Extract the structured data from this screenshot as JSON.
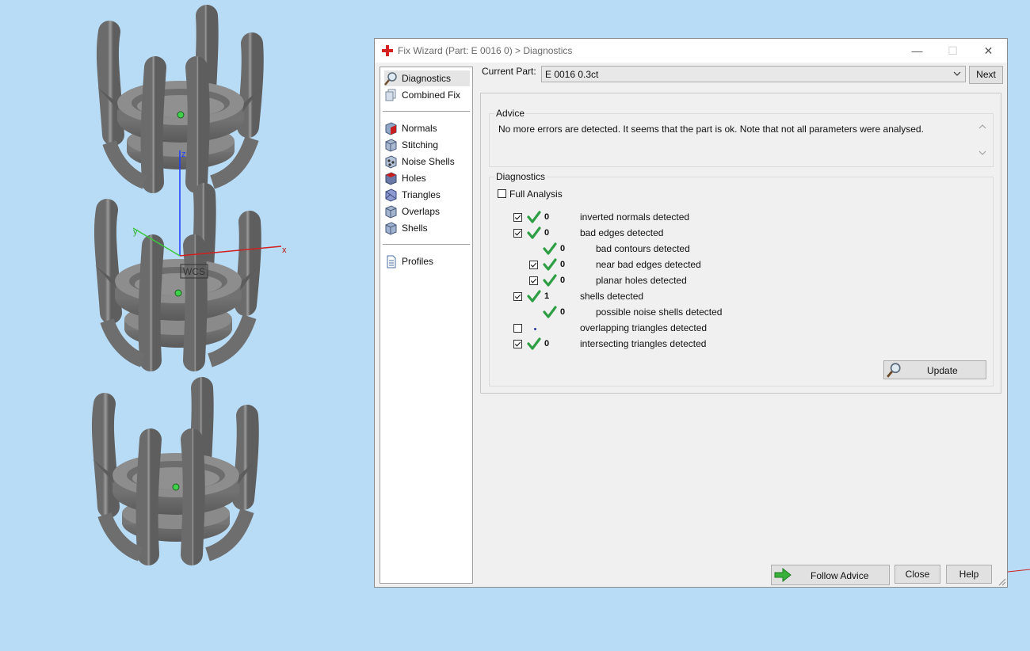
{
  "window": {
    "title": "Fix Wizard (Part: E 0016 0) > Diagnostics",
    "minimize_glyph": "—",
    "maximize_glyph": "☐",
    "close_glyph": "✕"
  },
  "nav": {
    "group1": [
      {
        "label": "Diagnostics",
        "icon": "magnifier-icon",
        "selected": true
      },
      {
        "label": "Combined Fix",
        "icon": "combined-fix-icon"
      }
    ],
    "group2": [
      {
        "label": "Normals",
        "icon": "normals-cube-icon"
      },
      {
        "label": "Stitching",
        "icon": "stitching-cube-icon"
      },
      {
        "label": "Noise Shells",
        "icon": "noise-shells-icon"
      },
      {
        "label": "Holes",
        "icon": "holes-cube-icon"
      },
      {
        "label": "Triangles",
        "icon": "triangles-cube-icon"
      },
      {
        "label": "Overlaps",
        "icon": "overlaps-cube-icon"
      },
      {
        "label": "Shells",
        "icon": "shells-cube-icon"
      }
    ],
    "group3": [
      {
        "label": "Profiles",
        "icon": "profiles-document-icon"
      }
    ]
  },
  "current_part": {
    "label": "Current Part:",
    "value": "E 0016 0.3ct",
    "next_label": "Next"
  },
  "advice": {
    "title": "Advice",
    "text": "No more errors are detected. It seems that the part is ok. Note that not all parameters were analysed."
  },
  "diagnostics": {
    "title": "Diagnostics",
    "full_analysis_label": "Full Analysis",
    "full_analysis_checked": false,
    "rows": [
      {
        "checkbox": true,
        "checked": true,
        "status": "ok",
        "count": "0",
        "desc": "inverted normals detected",
        "indent": 0
      },
      {
        "checkbox": true,
        "checked": true,
        "status": "ok",
        "count": "0",
        "desc": "bad edges detected",
        "indent": 0
      },
      {
        "checkbox": false,
        "checked": false,
        "status": "ok",
        "count": "0",
        "desc": "bad contours detected",
        "indent": 1
      },
      {
        "checkbox": true,
        "checked": true,
        "status": "ok",
        "count": "0",
        "desc": "near bad edges detected",
        "indent": 1
      },
      {
        "checkbox": true,
        "checked": true,
        "status": "ok",
        "count": "0",
        "desc": "planar holes detected",
        "indent": 1
      },
      {
        "checkbox": true,
        "checked": true,
        "status": "ok",
        "count": "1",
        "desc": "shells detected",
        "indent": 0
      },
      {
        "checkbox": false,
        "checked": false,
        "status": "ok",
        "count": "0",
        "desc": "possible noise shells detected",
        "indent": 1
      },
      {
        "checkbox": true,
        "checked": false,
        "status": "none",
        "count": "",
        "desc": "overlapping triangles detected",
        "indent": 0
      },
      {
        "checkbox": true,
        "checked": true,
        "status": "ok",
        "count": "0",
        "desc": "intersecting triangles detected",
        "indent": 0
      }
    ],
    "update_label": "Update"
  },
  "footer": {
    "follow_advice_label": "Follow Advice",
    "close_label": "Close",
    "help_label": "Help"
  },
  "viewport": {
    "wcs_label": "WCS",
    "axis_x": "x",
    "axis_y": "y",
    "axis_z": "z",
    "background": "#b9dcf6",
    "part_color": "#7a7a7a"
  },
  "colors": {
    "check_green": "#2e9e44",
    "arrow_green": "#38b13a",
    "title_red": "#d42020"
  }
}
